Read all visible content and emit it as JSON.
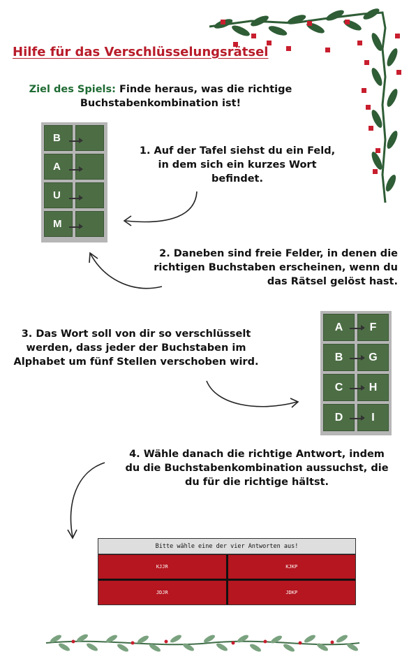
{
  "title": "Hilfe für das Verschlüsselungsrätsel",
  "goal": {
    "label": "Ziel des Spiels:",
    "line1": "Finde heraus, was die richtige",
    "line2": "Buchstabenkombination ist!"
  },
  "steps": {
    "step1": [
      "1. Auf der Tafel siehst du ein Feld,",
      "in dem sich ein kurzes Wort",
      "befindet."
    ],
    "step2": [
      "2. Daneben sind freie Felder, in denen die",
      "richtigen Buchstaben erscheinen, wenn du",
      "das Rätsel gelöst hast."
    ],
    "step3": [
      "3. Das Wort soll von dir so verschlüsselt",
      "werden, dass jeder der Buchstaben im",
      "Alphabet um fünf Stellen verschoben wird."
    ],
    "step4": [
      "4. Wähle danach die richtige Antwort, indem",
      "du die Buchstabenkombination aussuchst, die",
      "du für die richtige hältst."
    ]
  },
  "board1": {
    "letters": [
      "B",
      "A",
      "U",
      "M"
    ]
  },
  "board2": {
    "rows": [
      {
        "from": "A",
        "to": "F"
      },
      {
        "from": "B",
        "to": "G"
      },
      {
        "from": "C",
        "to": "H"
      },
      {
        "from": "D",
        "to": "I"
      }
    ]
  },
  "answers": {
    "prompt": "Bitte wähle eine der vier Antworten aus!",
    "options": [
      "KJJR",
      "KJKP",
      "JDJR",
      "JDKP"
    ]
  },
  "colors": {
    "title_red": "#b81c2a",
    "goal_green": "#1f6b33",
    "cell_green": "#4d6e45",
    "answer_red": "#b5161f",
    "board_gray": "#b6b6b6"
  }
}
